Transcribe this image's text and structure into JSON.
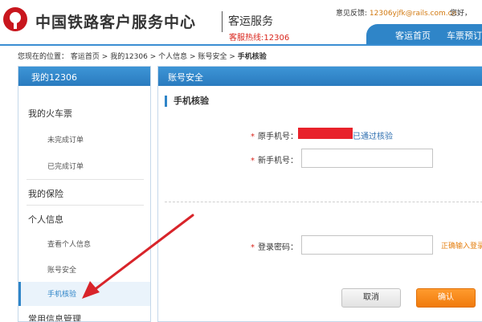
{
  "header": {
    "site_title": "中国铁路客户服务中心",
    "site_subtitle": "客运服务",
    "hotline": "客服热线:12306",
    "feedback_label": "意见反馈:",
    "feedback_email": "12306yjfk@rails.com.cn",
    "greeting": "您好，",
    "nav": [
      "客运首页",
      "车票预订"
    ]
  },
  "breadcrumb": {
    "prefix": "您现在的位置：",
    "items": [
      "客运首页",
      "我的12306",
      "个人信息",
      "账号安全"
    ],
    "separator": ">",
    "current": "手机核验"
  },
  "sidebar": {
    "title": "我的12306",
    "items": [
      {
        "label": "我的火车票",
        "level": 1
      },
      {
        "label": "未完成订单",
        "level": 2
      },
      {
        "label": "已完成订单",
        "level": 2
      },
      {
        "label": "我的保险",
        "level": 1
      },
      {
        "label": "个人信息",
        "level": 1
      },
      {
        "label": "查看个人信息",
        "level": 2
      },
      {
        "label": "账号安全",
        "level": 2
      },
      {
        "label": "手机核验",
        "level": 2,
        "active": true
      },
      {
        "label": "常用信息管理",
        "level": 1
      }
    ]
  },
  "panel": {
    "title": "账号安全",
    "section_title": "手机核验",
    "original_phone_label": "原手机号：",
    "original_phone_status": "已通过核验",
    "new_phone_label": "新手机号：",
    "new_phone_value": "",
    "password_label": "登录密码：",
    "password_value": "",
    "password_hint": "正确输入登录密码",
    "cancel_label": "取消",
    "confirm_label": "确认",
    "required_mark": "*"
  },
  "colors": {
    "brand_blue": "#2f85c8",
    "brand_red": "#c8161d",
    "confirm_orange": "#f07a0c",
    "hint_orange": "#e57f10"
  }
}
